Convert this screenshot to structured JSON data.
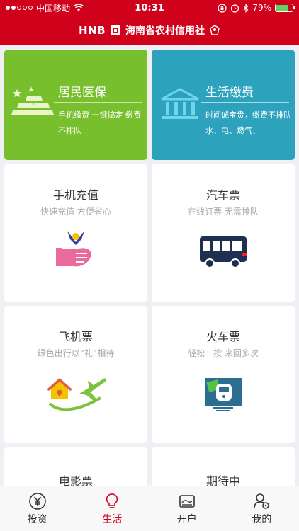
{
  "status": {
    "carrier": "中国移动",
    "time": "10:31",
    "battery": "79%"
  },
  "header": {
    "brand": "HNB",
    "title": "海南省农村信用社"
  },
  "cards": [
    {
      "title": "居民医保",
      "desc": "手机缴费 一键搞定 缴费不排队"
    },
    {
      "title": "生活缴费",
      "desc": "时间诚宝贵，缴费不排队 水、电、燃气、"
    }
  ],
  "tiles": [
    {
      "title": "手机充值",
      "subtitle": "快速充值 方便省心"
    },
    {
      "title": "汽车票",
      "subtitle": "在线订票 无需排队"
    },
    {
      "title": "飞机票",
      "subtitle": "绿色出行以“礼”相待"
    },
    {
      "title": "火车票",
      "subtitle": "轻松一按 来回多次"
    },
    {
      "title": "电影票",
      "subtitle": ""
    },
    {
      "title": "期待中",
      "subtitle": ""
    }
  ],
  "tabs": [
    {
      "label": "投资"
    },
    {
      "label": "生活"
    },
    {
      "label": "开户"
    },
    {
      "label": "我的"
    }
  ],
  "colors": {
    "brand": "#d0021b",
    "green": "#78bf2e",
    "teal": "#2ca2bd"
  }
}
